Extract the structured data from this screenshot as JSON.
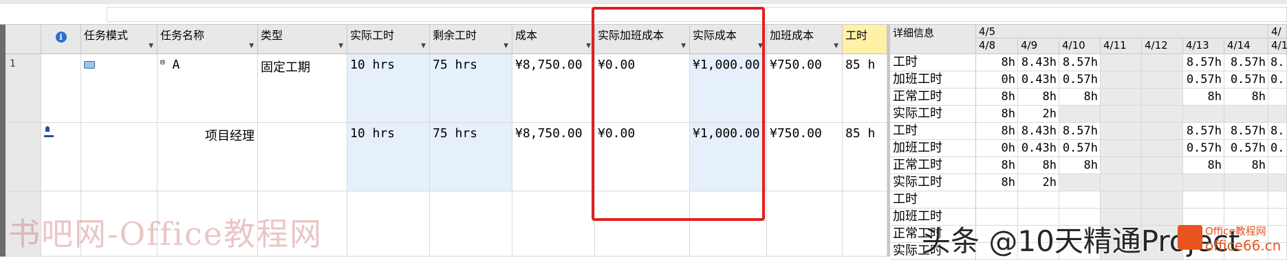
{
  "columns": {
    "info": "ℹ",
    "task_mode": "任务模式",
    "task_name": "任务名称",
    "type": "类型",
    "actual_work": "实际工时",
    "remaining_work": "剩余工时",
    "cost": "成本",
    "actual_overtime_cost": "实际加班成本",
    "actual_cost": "实际成本",
    "overtime_cost": "加班成本",
    "work": "工时"
  },
  "rows": [
    {
      "num": "1",
      "mode_icon": "auto-schedule-icon",
      "collapse": "⊟",
      "name": "A",
      "type": "固定工期",
      "actual_work": "10 hrs",
      "remaining_work": "75 hrs",
      "cost": "¥8,750.00",
      "actual_overtime_cost": "¥0.00",
      "actual_cost": "¥1,000.00",
      "overtime_cost": "¥750.00",
      "work": "85 h"
    },
    {
      "num": "",
      "indicator": "resource-icon",
      "name": "项目经理",
      "type": "",
      "actual_work": "10 hrs",
      "remaining_work": "75 hrs",
      "cost": "¥8,750.00",
      "actual_overtime_cost": "¥0.00",
      "actual_cost": "¥1,000.00",
      "overtime_cost": "¥750.00",
      "work": "85 h"
    }
  ],
  "detail": {
    "header": "详细信息",
    "week1": "4/5",
    "week2": "4/",
    "dates": [
      "4/8",
      "4/9",
      "4/10",
      "4/11",
      "4/12",
      "4/13",
      "4/14",
      "4/1"
    ],
    "labels": [
      "工时",
      "加班工时",
      "正常工时",
      "实际工时"
    ],
    "task_values": [
      [
        "8h",
        "8.43h",
        "8.57h",
        "",
        "",
        "8.57h",
        "8.57h",
        "8."
      ],
      [
        "0h",
        "0.43h",
        "0.57h",
        "",
        "",
        "0.57h",
        "0.57h",
        "0."
      ],
      [
        "8h",
        "8h",
        "8h",
        "",
        "",
        "8h",
        "8h",
        ""
      ],
      [
        "8h",
        "2h",
        "",
        "",
        "",
        "",
        "",
        ""
      ]
    ],
    "res_values": [
      [
        "8h",
        "8.43h",
        "8.57h",
        "",
        "",
        "8.57h",
        "8.57h",
        "8."
      ],
      [
        "0h",
        "0.43h",
        "0.57h",
        "",
        "",
        "0.57h",
        "0.57h",
        "0."
      ],
      [
        "8h",
        "8h",
        "8h",
        "",
        "",
        "8h",
        "8h",
        ""
      ],
      [
        "8h",
        "2h",
        "",
        "",
        "",
        "",
        "",
        ""
      ]
    ]
  },
  "watermarks": {
    "left": "书吧网-Office教程网",
    "right": "头条 @10天精通Project",
    "logo1": "Office教程网",
    "logo2": "office66.cn"
  },
  "colors": {
    "highlight_box": "#e02020",
    "blue_fill": "#e5f0fb",
    "yellow_header": "#fff2a6"
  }
}
